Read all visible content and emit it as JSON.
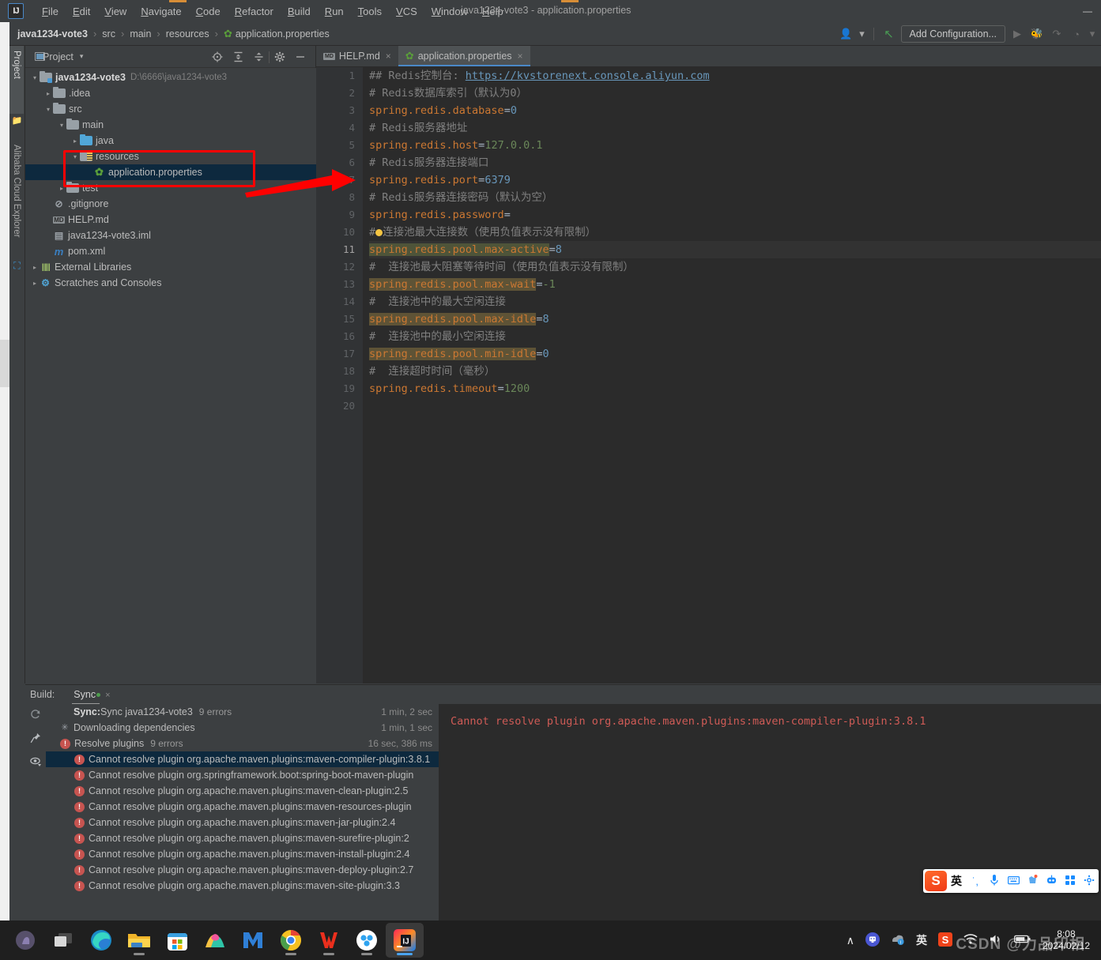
{
  "window": {
    "title": "java1234-vote3 - application.properties",
    "minimize_label": "—"
  },
  "menu": {
    "items": [
      "File",
      "Edit",
      "View",
      "Navigate",
      "Code",
      "Refactor",
      "Build",
      "Run",
      "Tools",
      "VCS",
      "Window",
      "Help"
    ]
  },
  "navbar": {
    "crumbs": [
      "java1234-vote3",
      "src",
      "main",
      "resources",
      "application.properties"
    ],
    "separator": "›",
    "add_configuration": "Add Configuration...",
    "icons": {
      "profile": "user-icon",
      "caret": "▾",
      "build_hammer": "↖",
      "run": "▶",
      "debug": "🐞",
      "coverage": "↱",
      "profiler": "◔",
      "dropdown": "▾",
      "search": "⚲"
    }
  },
  "left_strip": {
    "items": [
      {
        "label": "Project",
        "icon": "folder-icon",
        "active": true
      },
      {
        "label": "Alibaba Cloud Explorer",
        "icon": "cloud-icon",
        "active": false
      }
    ]
  },
  "project_panel": {
    "title": "Project",
    "dropdown_caret": "▾",
    "toolbar": [
      {
        "name": "locate-icon",
        "glyph": "⊕"
      },
      {
        "name": "expand-all-icon",
        "glyph": "⤓"
      },
      {
        "name": "collapse-all-icon",
        "glyph": "⤒"
      },
      {
        "name": "settings-gear-icon",
        "glyph": "⚙"
      },
      {
        "name": "hide-icon",
        "glyph": "—"
      }
    ],
    "tree": [
      {
        "depth": 0,
        "arrow": "∨",
        "icon": "module-folder",
        "label": "java1234-vote3",
        "bold": true,
        "path": "D:\\6666\\java1234-vote3"
      },
      {
        "depth": 1,
        "arrow": "›",
        "icon": "folder",
        "label": ".idea",
        "bold": false,
        "path": ""
      },
      {
        "depth": 1,
        "arrow": "∨",
        "icon": "folder",
        "label": "src",
        "bold": false,
        "path": ""
      },
      {
        "depth": 2,
        "arrow": "∨",
        "icon": "folder",
        "label": "main",
        "bold": false,
        "path": ""
      },
      {
        "depth": 3,
        "arrow": "›",
        "icon": "folder-blue",
        "label": "java",
        "bold": false,
        "path": ""
      },
      {
        "depth": 3,
        "arrow": "∨",
        "icon": "folder-resources",
        "label": "resources",
        "bold": false,
        "path": ""
      },
      {
        "depth": 4,
        "arrow": "",
        "icon": "spring-properties",
        "label": "application.properties",
        "bold": false,
        "path": "",
        "selected": true
      },
      {
        "depth": 2,
        "arrow": "›",
        "icon": "folder",
        "label": "test",
        "bold": false,
        "path": ""
      },
      {
        "depth": 1,
        "arrow": "",
        "icon": "gitignore-file",
        "label": ".gitignore",
        "bold": false,
        "path": ""
      },
      {
        "depth": 1,
        "arrow": "",
        "icon": "markdown-file",
        "label": "HELP.md",
        "bold": false,
        "path": ""
      },
      {
        "depth": 1,
        "arrow": "",
        "icon": "iml-file",
        "label": "java1234-vote3.iml",
        "bold": false,
        "path": ""
      },
      {
        "depth": 1,
        "arrow": "",
        "icon": "maven-file",
        "label": "pom.xml",
        "bold": false,
        "path": ""
      },
      {
        "depth": 0,
        "arrow": "›",
        "icon": "libraries",
        "label": "External Libraries",
        "bold": false,
        "path": ""
      },
      {
        "depth": 0,
        "arrow": "›",
        "icon": "scratches",
        "label": "Scratches and Consoles",
        "bold": false,
        "path": ""
      }
    ]
  },
  "editor": {
    "tabs": [
      {
        "label": "HELP.md",
        "icon": "markdown-file",
        "active": false,
        "close": "×"
      },
      {
        "label": "application.properties",
        "icon": "spring-properties",
        "active": true,
        "close": "×"
      }
    ],
    "line_count": 20,
    "current_line": 11,
    "lines": [
      {
        "n": 1,
        "type": "comment-url",
        "text": "## Redis控制台: ",
        "url": "https://kvstorenext.console.aliyun.com"
      },
      {
        "n": 2,
        "type": "comment",
        "text": "# Redis数据库索引（默认为0）"
      },
      {
        "n": 3,
        "type": "prop",
        "key": "spring.redis.database",
        "value": "0",
        "value_kind": "num",
        "highlight": ""
      },
      {
        "n": 4,
        "type": "comment",
        "text": "# Redis服务器地址"
      },
      {
        "n": 5,
        "type": "prop",
        "key": "spring.redis.host",
        "value": "127.0.0.1",
        "value_kind": "str",
        "highlight": ""
      },
      {
        "n": 6,
        "type": "comment",
        "text": "# Redis服务器连接端口"
      },
      {
        "n": 7,
        "type": "prop",
        "key": "spring.redis.port",
        "value": "6379",
        "value_kind": "num",
        "highlight": ""
      },
      {
        "n": 8,
        "type": "comment",
        "text": "# Redis服务器连接密码（默认为空）"
      },
      {
        "n": 9,
        "type": "prop",
        "key": "spring.redis.password",
        "value": "",
        "value_kind": "str",
        "highlight": ""
      },
      {
        "n": 10,
        "type": "comment-bulb",
        "text": "#连接池最大连接数（使用负值表示没有限制）"
      },
      {
        "n": 11,
        "type": "prop",
        "key": "spring.redis.pool.max-active",
        "value": "8",
        "value_kind": "num",
        "highlight": "green",
        "current": true
      },
      {
        "n": 12,
        "type": "comment",
        "text": "#  连接池最大阻塞等待时间（使用负值表示没有限制）"
      },
      {
        "n": 13,
        "type": "prop",
        "key": "spring.redis.pool.max-wait",
        "value": "-1",
        "value_kind": "str",
        "highlight": "tan"
      },
      {
        "n": 14,
        "type": "comment",
        "text": "#  连接池中的最大空闲连接"
      },
      {
        "n": 15,
        "type": "prop",
        "key": "spring.redis.pool.max-idle",
        "value": "8",
        "value_kind": "num",
        "highlight": "tan"
      },
      {
        "n": 16,
        "type": "comment",
        "text": "#  连接池中的最小空闲连接"
      },
      {
        "n": 17,
        "type": "prop",
        "key": "spring.redis.pool.min-idle",
        "value": "0",
        "value_kind": "num",
        "highlight": "tan"
      },
      {
        "n": 18,
        "type": "comment",
        "text": "#  连接超时时间（毫秒）"
      },
      {
        "n": 19,
        "type": "prop",
        "key": "spring.redis.timeout",
        "value": "1200",
        "value_kind": "str",
        "highlight": ""
      },
      {
        "n": 20,
        "type": "empty",
        "text": ""
      }
    ]
  },
  "build_panel": {
    "label": "Build:",
    "tab": "Sync",
    "tab_close": "×",
    "gutter_icons": [
      {
        "name": "rerun-icon",
        "glyph": "↺"
      },
      {
        "name": "pin-icon",
        "glyph": "📌"
      },
      {
        "name": "eye-toggle-icon",
        "glyph": "👁"
      }
    ],
    "rows": [
      {
        "indent": 0,
        "icon": "none",
        "bold_prefix": "Sync:",
        "label": " Sync java1234-vote3",
        "count": "9 errors",
        "time": "1 min, 2 sec",
        "selected": false
      },
      {
        "indent": 0,
        "icon": "spinner",
        "bold_prefix": "",
        "label": "Downloading dependencies",
        "count": "",
        "time": "1 min, 1 sec",
        "selected": false
      },
      {
        "indent": 0,
        "icon": "error",
        "bold_prefix": "",
        "label": "Resolve plugins",
        "count": "9 errors",
        "time": "16 sec, 386 ms",
        "selected": false
      },
      {
        "indent": 1,
        "icon": "error",
        "bold_prefix": "",
        "label": "Cannot resolve plugin org.apache.maven.plugins:maven-compiler-plugin:3.8.1",
        "count": "",
        "time": "",
        "selected": true
      },
      {
        "indent": 1,
        "icon": "error",
        "bold_prefix": "",
        "label": "Cannot resolve plugin org.springframework.boot:spring-boot-maven-plugin",
        "count": "",
        "time": "",
        "selected": false
      },
      {
        "indent": 1,
        "icon": "error",
        "bold_prefix": "",
        "label": "Cannot resolve plugin org.apache.maven.plugins:maven-clean-plugin:2.5",
        "count": "",
        "time": "",
        "selected": false
      },
      {
        "indent": 1,
        "icon": "error",
        "bold_prefix": "",
        "label": "Cannot resolve plugin org.apache.maven.plugins:maven-resources-plugin",
        "count": "",
        "time": "",
        "selected": false
      },
      {
        "indent": 1,
        "icon": "error",
        "bold_prefix": "",
        "label": "Cannot resolve plugin org.apache.maven.plugins:maven-jar-plugin:2.4",
        "count": "",
        "time": "",
        "selected": false
      },
      {
        "indent": 1,
        "icon": "error",
        "bold_prefix": "",
        "label": "Cannot resolve plugin org.apache.maven.plugins:maven-surefire-plugin:2",
        "count": "",
        "time": "",
        "selected": false
      },
      {
        "indent": 1,
        "icon": "error",
        "bold_prefix": "",
        "label": "Cannot resolve plugin org.apache.maven.plugins:maven-install-plugin:2.4",
        "count": "",
        "time": "",
        "selected": false
      },
      {
        "indent": 1,
        "icon": "error",
        "bold_prefix": "",
        "label": "Cannot resolve plugin org.apache.maven.plugins:maven-deploy-plugin:2.7",
        "count": "",
        "time": "",
        "selected": false
      },
      {
        "indent": 1,
        "icon": "error",
        "bold_prefix": "",
        "label": "Cannot resolve plugin org.apache.maven.plugins:maven-site-plugin:3.3",
        "count": "",
        "time": "",
        "selected": false
      }
    ],
    "detail_message": "Cannot resolve plugin org.apache.maven.plugins:maven-compiler-plugin:3.8.1"
  },
  "ime_bar": {
    "logo": "S",
    "items": [
      {
        "name": "language-mode",
        "glyph": "英"
      },
      {
        "name": "punctuation-icon",
        "glyph": "˙,"
      },
      {
        "name": "voice-input-icon",
        "glyph": "🎙"
      },
      {
        "name": "soft-keyboard-icon",
        "glyph": "⌨"
      },
      {
        "name": "skin-icon",
        "glyph": "👕"
      },
      {
        "name": "toolbox-icon",
        "glyph": "⚙"
      },
      {
        "name": "apps-icon",
        "glyph": "∷"
      },
      {
        "name": "settings-icon",
        "glyph": "✿"
      }
    ]
  },
  "taskbar": {
    "apps": [
      {
        "name": "start-button",
        "glyph": "⊞",
        "active": false,
        "running": false
      },
      {
        "name": "task-view-button",
        "glyph": "▣",
        "active": false,
        "running": false
      },
      {
        "name": "microsoft-edge",
        "glyph": "e",
        "active": false,
        "running": false
      },
      {
        "name": "file-explorer",
        "glyph": "🗀",
        "active": false,
        "running": true
      },
      {
        "name": "microsoft-store",
        "glyph": "🛍",
        "active": false,
        "running": false
      },
      {
        "name": "alibaba-app",
        "glyph": "▲",
        "active": false,
        "running": false
      },
      {
        "name": "mail-app",
        "glyph": "M",
        "active": false,
        "running": false
      },
      {
        "name": "google-chrome",
        "glyph": "●",
        "active": false,
        "running": true
      },
      {
        "name": "wps-office",
        "glyph": "W",
        "active": false,
        "running": true
      },
      {
        "name": "baidu-netdisk",
        "glyph": "♨",
        "active": false,
        "running": true
      },
      {
        "name": "intellij-idea",
        "glyph": "IJ",
        "active": true,
        "running": true
      }
    ],
    "tray": [
      {
        "name": "show-hidden-icons",
        "glyph": "∧"
      },
      {
        "name": "qq-icon",
        "glyph": "🐧"
      },
      {
        "name": "security-icon",
        "glyph": "ⓘ"
      },
      {
        "name": "ime-indicator",
        "glyph": "英"
      },
      {
        "name": "sogou-icon",
        "glyph": "S"
      },
      {
        "name": "network-icon",
        "glyph": "◖"
      },
      {
        "name": "volume-icon",
        "glyph": "🔊"
      },
      {
        "name": "battery-icon",
        "glyph": "🔋"
      }
    ],
    "clock_time": "8:08",
    "clock_date": "2024/02/12"
  },
  "watermark": "CSDN @力品印相",
  "colors": {
    "accent_blue": "#4a88c7",
    "panel_bg": "#3c3f41",
    "editor_bg": "#2b2b2b",
    "selection": "#0d293e",
    "error_red": "#c75450",
    "annotation_red": "#ff0000",
    "property_key": "#cc7832",
    "number": "#6897bb",
    "string": "#6a8759",
    "comment": "#808080"
  }
}
